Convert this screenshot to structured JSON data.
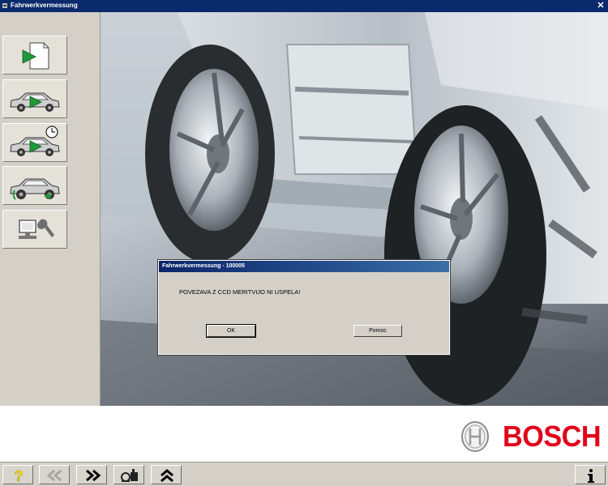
{
  "window": {
    "title": "Fahrwerkvermessung"
  },
  "sidebar": {
    "items": [
      {
        "name": "document-arrow"
      },
      {
        "name": "car-measure"
      },
      {
        "name": "car-measure-timed"
      },
      {
        "name": "car-wheel-runout"
      },
      {
        "name": "computer-settings"
      }
    ]
  },
  "dialog": {
    "title": "Fahrwerkvermessung - 100005",
    "message": "POVEZAVA Z CCD MERITVIJO NI USPELA!",
    "ok_label": "OK",
    "help_label": "Pomoc"
  },
  "brand": {
    "name": "BOSCH",
    "color": "#e2001a"
  },
  "toolbar": {
    "help_symbol": "?",
    "help_color": "#ffe000"
  },
  "colors": {
    "accent_green": "#1f9a3a",
    "title_bar": "#0b2a6b"
  }
}
